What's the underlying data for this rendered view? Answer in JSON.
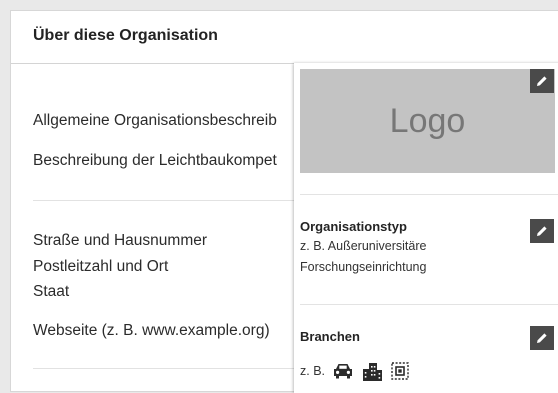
{
  "card": {
    "title": "Über diese Organisation"
  },
  "left": {
    "general_description": "Allgemeine Organisationsbeschreib",
    "lightweight_description": "Beschreibung der Leichtbaukompet",
    "street": "Straße und Hausnummer",
    "postal_city": "Postleitzahl und Ort",
    "country": "Staat",
    "website": "Webseite (z. B. www.example.org)"
  },
  "panel": {
    "logo_label": "Logo",
    "org_type": {
      "title": "Organisationstyp",
      "line1": "z. B. Außeruniversitäre",
      "line2": "Forschungseinrichtung"
    },
    "sectors": {
      "title": "Branchen",
      "example_prefix": "z. B.",
      "example_icons": [
        "car-icon",
        "buildings-icon",
        "circuit-chip-icon"
      ]
    }
  },
  "icons": {
    "edit": "pencil-icon"
  },
  "colors": {
    "edit_button_bg": "#4a4a4a",
    "logo_placeholder_bg": "#c3c3c3"
  }
}
